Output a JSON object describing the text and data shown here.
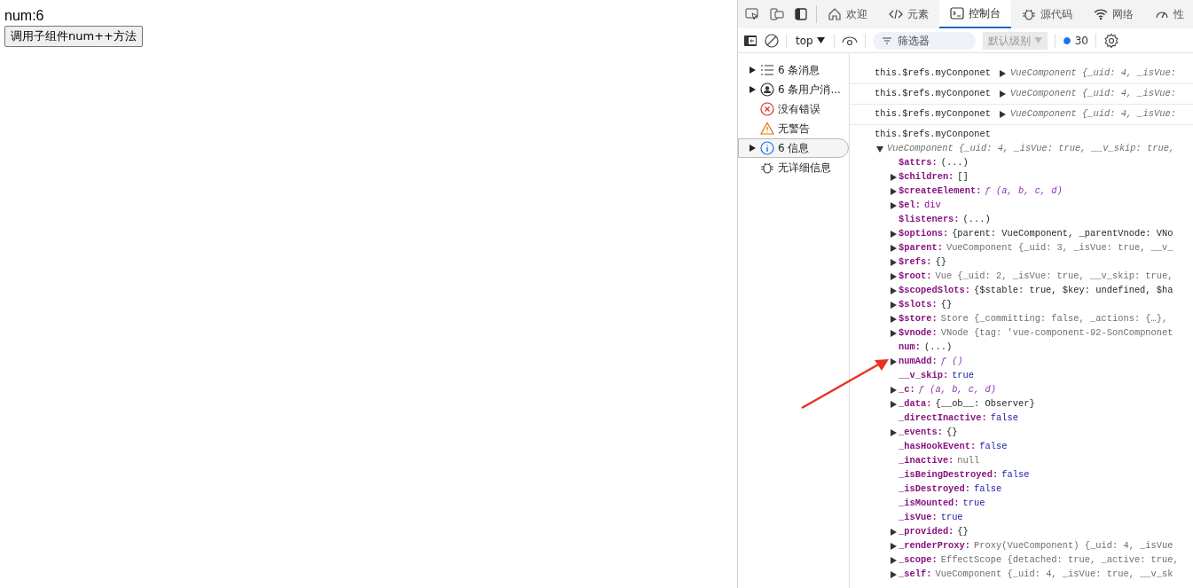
{
  "page": {
    "counter_text": "num:6",
    "button_label": "调用子组件num++方法"
  },
  "devtools": {
    "tabs": [
      {
        "label": "欢迎",
        "kind": "home",
        "selected": false
      },
      {
        "label": "元素",
        "kind": "code",
        "selected": false
      },
      {
        "label": "控制台",
        "kind": "console",
        "selected": true
      },
      {
        "label": "源代码",
        "kind": "bug",
        "selected": false
      },
      {
        "label": "网络",
        "kind": "wifi",
        "selected": false
      },
      {
        "label": "性",
        "kind": "gauge",
        "selected": false
      }
    ],
    "toolbar": {
      "context": "top",
      "filter_placeholder": "筛选器",
      "level": "默认级别",
      "level_disabled": true,
      "message_count": "30"
    },
    "sidebar": [
      {
        "label": "6 条消息",
        "kind": "list",
        "expandable": true,
        "selected": false
      },
      {
        "label": "6 条用户消...",
        "kind": "user",
        "expandable": true,
        "selected": false
      },
      {
        "label": "没有错误",
        "kind": "error",
        "expandable": false,
        "selected": false
      },
      {
        "label": "无警告",
        "kind": "warning",
        "expandable": false,
        "selected": false
      },
      {
        "label": "6 信息",
        "kind": "info",
        "expandable": true,
        "selected": true
      },
      {
        "label": "无详细信息",
        "kind": "bug",
        "expandable": false,
        "selected": false
      }
    ],
    "logs": [
      {
        "label": "this.$refs.myConponet",
        "expanded": false,
        "preview": "VueComponent {_uid: 4, _isVue:"
      },
      {
        "label": "this.$refs.myConponet",
        "expanded": false,
        "preview": "VueComponent {_uid: 4, _isVue:"
      },
      {
        "label": "this.$refs.myConponet",
        "expanded": false,
        "preview": "VueComponent {_uid: 4, _isVue:"
      },
      {
        "label": "this.$refs.myConponet",
        "expanded": true,
        "preview": "VueComponent {_uid: 4, _isVue: true, __v_skip: true,",
        "properties": [
          {
            "key": "$attrs:",
            "expandable": false,
            "kind": "plain",
            "value": "(...)"
          },
          {
            "key": "$children:",
            "expandable": true,
            "kind": "plain",
            "value": "[]"
          },
          {
            "key": "$createElement:",
            "expandable": true,
            "kind": "func",
            "value": "ƒ (a, b, c, d)"
          },
          {
            "key": "$el:",
            "expandable": true,
            "kind": "tag",
            "value": "div"
          },
          {
            "key": "$listeners:",
            "expandable": false,
            "kind": "plain",
            "value": "(...)"
          },
          {
            "key": "$options:",
            "expandable": true,
            "kind": "plain",
            "value": "{parent: VueComponent, _parentVnode: VNo"
          },
          {
            "key": "$parent:",
            "expandable": true,
            "kind": "dim",
            "value": "VueComponent {_uid: 3, _isVue: true, __v_"
          },
          {
            "key": "$refs:",
            "expandable": true,
            "kind": "plain",
            "value": "{}"
          },
          {
            "key": "$root:",
            "expandable": true,
            "kind": "dim",
            "value": "Vue {_uid: 2, _isVue: true, __v_skip: true,"
          },
          {
            "key": "$scopedSlots:",
            "expandable": true,
            "kind": "plain",
            "value": "{$stable: true, $key: undefined, $ha"
          },
          {
            "key": "$slots:",
            "expandable": true,
            "kind": "plain",
            "value": "{}"
          },
          {
            "key": "$store:",
            "expandable": true,
            "kind": "dim",
            "value": "Store {_committing: false, _actions: {…},"
          },
          {
            "key": "$vnode:",
            "expandable": true,
            "kind": "dim",
            "value": "VNode {tag: 'vue-component-92-SonCompnonet"
          },
          {
            "key": "num:",
            "expandable": false,
            "kind": "plain",
            "value": "(...)"
          },
          {
            "key": "numAdd:",
            "expandable": true,
            "kind": "func",
            "value": "ƒ ()"
          },
          {
            "key": "__v_skip:",
            "expandable": false,
            "kind": "keyword",
            "value": "true"
          },
          {
            "key": "_c:",
            "expandable": true,
            "kind": "func",
            "value": "ƒ (a, b, c, d)"
          },
          {
            "key": "_data:",
            "expandable": true,
            "kind": "plain",
            "value": "{__ob__: Observer}"
          },
          {
            "key": "_directInactive:",
            "expandable": false,
            "kind": "keyword",
            "value": "false"
          },
          {
            "key": "_events:",
            "expandable": true,
            "kind": "plain",
            "value": "{}"
          },
          {
            "key": "_hasHookEvent:",
            "expandable": false,
            "kind": "keyword",
            "value": "false"
          },
          {
            "key": "_inactive:",
            "expandable": false,
            "kind": "dim",
            "value": "null"
          },
          {
            "key": "_isBeingDestroyed:",
            "expandable": false,
            "kind": "keyword",
            "value": "false"
          },
          {
            "key": "_isDestroyed:",
            "expandable": false,
            "kind": "keyword",
            "value": "false"
          },
          {
            "key": "_isMounted:",
            "expandable": false,
            "kind": "keyword",
            "value": "true"
          },
          {
            "key": "_isVue:",
            "expandable": false,
            "kind": "keyword",
            "value": "true"
          },
          {
            "key": "_provided:",
            "expandable": true,
            "kind": "plain",
            "value": "{}"
          },
          {
            "key": "_renderProxy:",
            "expandable": true,
            "kind": "dim",
            "value": "Proxy(VueComponent) {_uid: 4, _isVue"
          },
          {
            "key": "_scope:",
            "expandable": true,
            "kind": "dim",
            "value": "EffectScope {detached: true, _active: true,"
          },
          {
            "key": "_self:",
            "expandable": true,
            "kind": "dim",
            "value": "VueComponent {_uid: 4, _isVue: true, __v_sk"
          }
        ]
      }
    ]
  }
}
